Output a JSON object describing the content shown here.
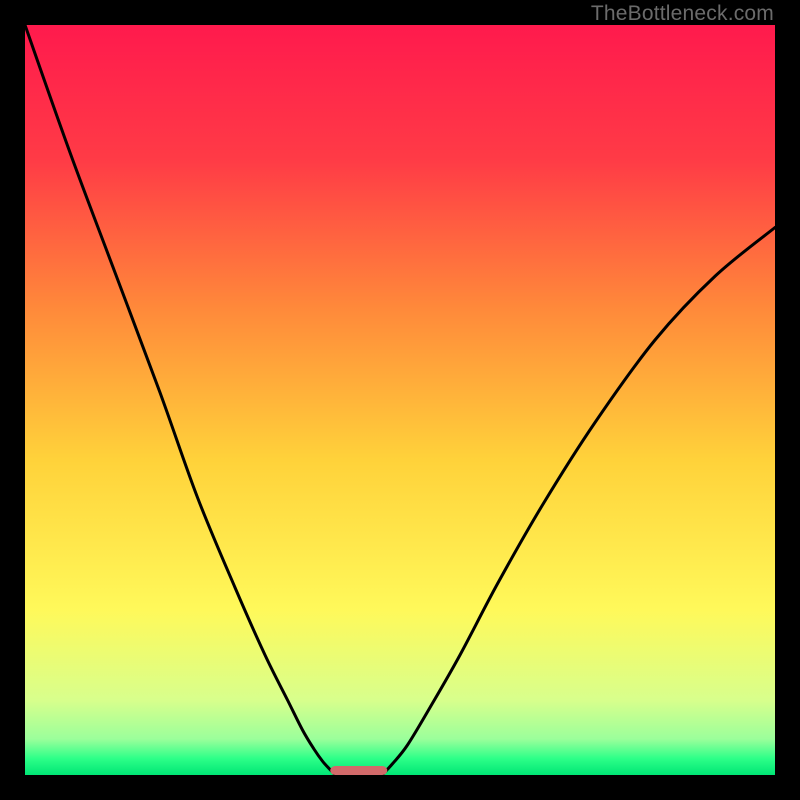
{
  "watermark": "TheBottleneck.com",
  "chart_data": {
    "type": "line",
    "title": "",
    "xlabel": "",
    "ylabel": "",
    "xlim": [
      0,
      1
    ],
    "ylim": [
      0,
      1
    ],
    "background_gradient_stops": [
      {
        "offset": 0.0,
        "color": "#ff1a4d"
      },
      {
        "offset": 0.18,
        "color": "#ff3b46"
      },
      {
        "offset": 0.38,
        "color": "#ff8a3a"
      },
      {
        "offset": 0.58,
        "color": "#ffd23a"
      },
      {
        "offset": 0.78,
        "color": "#fff95a"
      },
      {
        "offset": 0.9,
        "color": "#d8ff8c"
      },
      {
        "offset": 0.952,
        "color": "#9bff9b"
      },
      {
        "offset": 0.978,
        "color": "#2dff88"
      },
      {
        "offset": 1.0,
        "color": "#00e675"
      }
    ],
    "series": [
      {
        "name": "left-curve",
        "x": [
          0.0,
          0.06,
          0.12,
          0.18,
          0.23,
          0.28,
          0.32,
          0.35,
          0.37,
          0.385,
          0.397,
          0.407,
          0.414
        ],
        "y": [
          1.0,
          0.83,
          0.67,
          0.51,
          0.37,
          0.25,
          0.16,
          0.1,
          0.06,
          0.035,
          0.018,
          0.007,
          0.0
        ]
      },
      {
        "name": "right-curve",
        "x": [
          0.476,
          0.49,
          0.51,
          0.54,
          0.58,
          0.63,
          0.69,
          0.76,
          0.84,
          0.92,
          1.0
        ],
        "y": [
          0.0,
          0.015,
          0.04,
          0.09,
          0.16,
          0.255,
          0.36,
          0.47,
          0.58,
          0.665,
          0.73
        ]
      }
    ],
    "marker": {
      "name": "bottom-marker",
      "x_start": 0.407,
      "x_end": 0.483,
      "y": 0.006,
      "color": "#d26a6a",
      "thickness": 0.012
    },
    "plot_frame": {
      "stroke": "#000000",
      "fill_mode": "vertical-gradient"
    }
  }
}
